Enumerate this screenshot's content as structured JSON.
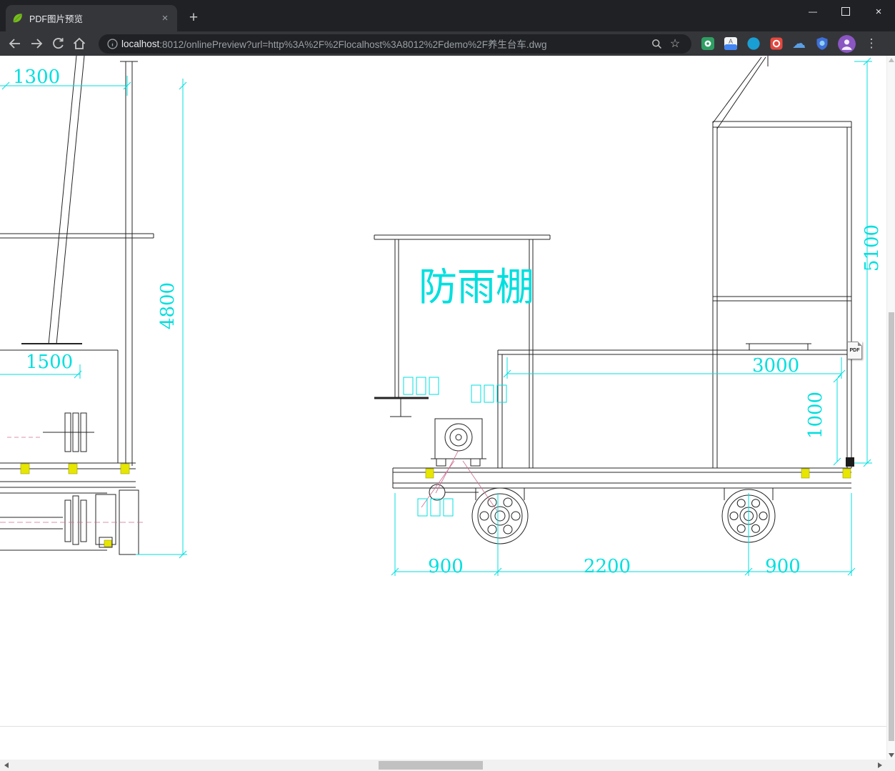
{
  "browser": {
    "tab_title": "PDF图片预览",
    "url_host": "localhost",
    "url_rest": ":8012/onlinePreview?url=http%3A%2F%2Flocalhost%3A8012%2Fdemo%2F养生台车.dwg"
  },
  "icons": {
    "close": "×",
    "new_tab": "+",
    "minimize": "—",
    "menu": "⋮",
    "star": "☆",
    "cloud": "☁",
    "translate_letter": "A"
  },
  "pdf_badge": {
    "label": "PDF"
  },
  "drawing": {
    "canopy_label": "防雨棚",
    "dims": {
      "top_width": "1300",
      "left_height": "4800",
      "hopper_width": "1500",
      "right_height": "5100",
      "deck_length": "3000",
      "deck_height": "1000",
      "axle_left": "900",
      "axle_center": "2200",
      "axle_right": "900"
    },
    "colors": {
      "dimension": "#00dfdf",
      "line": "#222222",
      "highlight": "#e6e600"
    }
  }
}
